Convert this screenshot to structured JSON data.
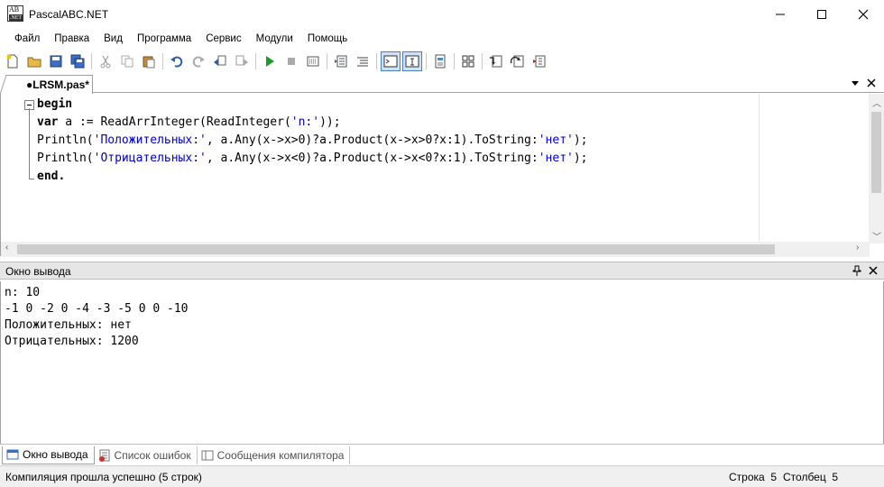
{
  "window": {
    "title": "PascalABC.NET"
  },
  "menu": {
    "items": [
      "Файл",
      "Правка",
      "Вид",
      "Программа",
      "Сервис",
      "Модули",
      "Помощь"
    ]
  },
  "editor": {
    "tab_label": "●LRSM.pas*",
    "lines": {
      "l1": "begin",
      "l2": {
        "kw": "var",
        "rest": " a := ReadArrInteger(ReadInteger(",
        "str": "'n:'",
        "end": "));"
      },
      "l3": {
        "a": "Println(",
        "str1": "'Положительных:'",
        "b": ", a.Any(x->x>0)?a.Product(x->x>0?x:1).ToString:",
        "str2": "'нет'",
        "c": ");"
      },
      "l4": {
        "a": "Println(",
        "str1": "'Отрицательных:'",
        "b": ", a.Any(x->x<0)?a.Product(x->x<0?x:1).ToString:",
        "str2": "'нет'",
        "c": ");"
      },
      "l5": "end."
    }
  },
  "output": {
    "header": "Окно вывода",
    "lines": [
      "n: 10",
      "-1 0 -2 0 -4 -3 -5 0 0 -10",
      "Положительных: нет",
      "Отрицательных: 1200"
    ]
  },
  "bottom_tabs": [
    "Окно вывода",
    "Список ошибок",
    "Сообщения компилятора"
  ],
  "status": {
    "message": "Компиляция прошла успешно (5 строк)",
    "row": "Строка  5",
    "col": "Столбец  5"
  }
}
